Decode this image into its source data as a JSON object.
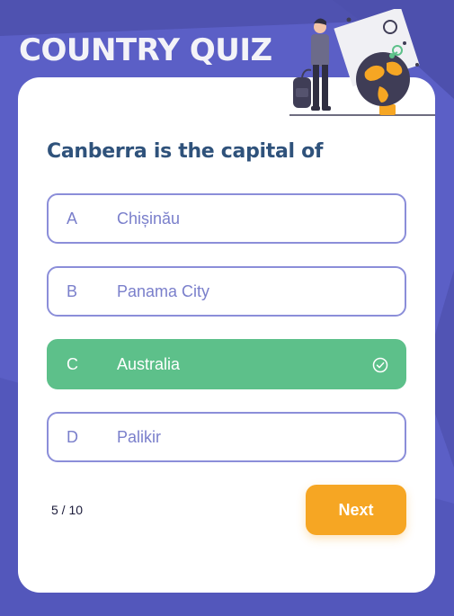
{
  "app": {
    "title": "COUNTRY QUIZ"
  },
  "quiz": {
    "question": "Canberra is the capital of",
    "options": [
      {
        "letter": "A",
        "text": "Chișinău"
      },
      {
        "letter": "B",
        "text": "Panama City"
      },
      {
        "letter": "C",
        "text": "Australia",
        "state": "correct"
      },
      {
        "letter": "D",
        "text": "Palikir"
      }
    ],
    "progress": {
      "current": 5,
      "total": 10,
      "label": "5 / 10"
    },
    "next_label": "Next"
  },
  "colors": {
    "background": "#5b5fc6",
    "option_border": "#8b8ed9",
    "option_text": "#7a7fcb",
    "correct": "#5dc08a",
    "accent": "#f6a623",
    "question_text": "#2f527b"
  },
  "icons": [
    "check-circle-icon",
    "traveler-illustration",
    "globe-illustration"
  ]
}
